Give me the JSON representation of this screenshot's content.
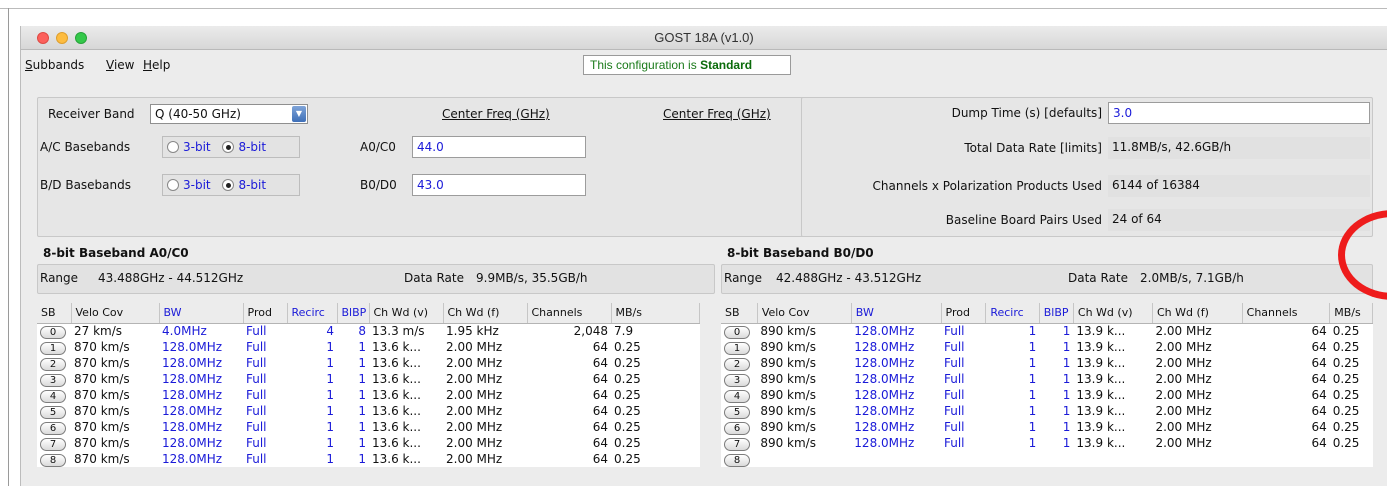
{
  "window": {
    "title": "GOST 18A (v1.0)"
  },
  "menu": {
    "items": [
      {
        "mnemonic": "S",
        "rest": "ubbands"
      },
      {
        "mnemonic": "V",
        "rest": "iew"
      },
      {
        "mnemonic": "H",
        "rest": "elp"
      }
    ]
  },
  "status": {
    "prefix": "This configuration is ",
    "value": "Standard"
  },
  "receiver": {
    "band_label": "Receiver Band",
    "band_value": "Q (40-50 GHz)",
    "ac_label": "A/C Basebands",
    "bd_label": "B/D Basebands",
    "opt3": "3-bit",
    "opt8": "8-bit",
    "ac_selected": "8-bit",
    "bd_selected": "8-bit",
    "center_freq_header_1": "Center Freq (GHz)",
    "center_freq_header_2": "Center Freq (GHz)",
    "a0_label": "A0/C0",
    "a0_value": "44.0",
    "b0_label": "B0/D0",
    "b0_value": "43.0"
  },
  "summary": {
    "dump_label": "Dump Time (s) [defaults]",
    "dump_value": "3.0",
    "rate_label": "Total Data Rate [limits]",
    "rate_value": "11.8MB/s, 42.6GB/h",
    "channels_label": "Channels x Polarization Products Used",
    "channels_value": "6144 of 16384",
    "boards_label": "Baseline Board Pairs Used",
    "boards_value": "24 of 64"
  },
  "columns": [
    "SB",
    "Velo Cov",
    "BW",
    "Prod",
    "Recirc",
    "BlBP",
    "Ch Wd (v)",
    "Ch Wd (f)",
    "Channels",
    "MB/s"
  ],
  "panel_a": {
    "title": "8-bit Baseband A0/C0",
    "range_label": "Range",
    "range_value": "43.488GHz - 44.512GHz",
    "rate_label": "Data Rate",
    "rate_value": "9.9MB/s, 35.5GB/h",
    "rows": [
      {
        "sb": "0",
        "velo": "27 km/s",
        "bw": "4.0MHz",
        "prod": "Full",
        "recirc": "4",
        "blbp": "8",
        "chv": "13.3 m/s",
        "chf": "1.95 kHz",
        "ch": "2,048",
        "mbs": "7.9"
      },
      {
        "sb": "1",
        "velo": "870 km/s",
        "bw": "128.0MHz",
        "prod": "Full",
        "recirc": "1",
        "blbp": "1",
        "chv": "13.6 k...",
        "chf": "2.00 MHz",
        "ch": "64",
        "mbs": "0.25"
      },
      {
        "sb": "2",
        "velo": "870 km/s",
        "bw": "128.0MHz",
        "prod": "Full",
        "recirc": "1",
        "blbp": "1",
        "chv": "13.6 k...",
        "chf": "2.00 MHz",
        "ch": "64",
        "mbs": "0.25"
      },
      {
        "sb": "3",
        "velo": "870 km/s",
        "bw": "128.0MHz",
        "prod": "Full",
        "recirc": "1",
        "blbp": "1",
        "chv": "13.6 k...",
        "chf": "2.00 MHz",
        "ch": "64",
        "mbs": "0.25"
      },
      {
        "sb": "4",
        "velo": "870 km/s",
        "bw": "128.0MHz",
        "prod": "Full",
        "recirc": "1",
        "blbp": "1",
        "chv": "13.6 k...",
        "chf": "2.00 MHz",
        "ch": "64",
        "mbs": "0.25"
      },
      {
        "sb": "5",
        "velo": "870 km/s",
        "bw": "128.0MHz",
        "prod": "Full",
        "recirc": "1",
        "blbp": "1",
        "chv": "13.6 k...",
        "chf": "2.00 MHz",
        "ch": "64",
        "mbs": "0.25"
      },
      {
        "sb": "6",
        "velo": "870 km/s",
        "bw": "128.0MHz",
        "prod": "Full",
        "recirc": "1",
        "blbp": "1",
        "chv": "13.6 k...",
        "chf": "2.00 MHz",
        "ch": "64",
        "mbs": "0.25"
      },
      {
        "sb": "7",
        "velo": "870 km/s",
        "bw": "128.0MHz",
        "prod": "Full",
        "recirc": "1",
        "blbp": "1",
        "chv": "13.6 k...",
        "chf": "2.00 MHz",
        "ch": "64",
        "mbs": "0.25"
      },
      {
        "sb": "8",
        "velo": "870 km/s",
        "bw": "128.0MHz",
        "prod": "Full",
        "recirc": "1",
        "blbp": "1",
        "chv": "13.6 k...",
        "chf": "2.00 MHz",
        "ch": "64",
        "mbs": "0.25"
      }
    ]
  },
  "panel_b": {
    "title": "8-bit Baseband B0/D0",
    "range_label": "Range",
    "range_value": "42.488GHz - 43.512GHz",
    "rate_label": "Data Rate",
    "rate_value": "2.0MB/s, 7.1GB/h",
    "rows": [
      {
        "sb": "0",
        "velo": "890 km/s",
        "bw": "128.0MHz",
        "prod": "Full",
        "recirc": "1",
        "blbp": "1",
        "chv": "13.9 k...",
        "chf": "2.00 MHz",
        "ch": "64",
        "mbs": "0.25"
      },
      {
        "sb": "1",
        "velo": "890 km/s",
        "bw": "128.0MHz",
        "prod": "Full",
        "recirc": "1",
        "blbp": "1",
        "chv": "13.9 k...",
        "chf": "2.00 MHz",
        "ch": "64",
        "mbs": "0.25"
      },
      {
        "sb": "2",
        "velo": "890 km/s",
        "bw": "128.0MHz",
        "prod": "Full",
        "recirc": "1",
        "blbp": "1",
        "chv": "13.9 k...",
        "chf": "2.00 MHz",
        "ch": "64",
        "mbs": "0.25"
      },
      {
        "sb": "3",
        "velo": "890 km/s",
        "bw": "128.0MHz",
        "prod": "Full",
        "recirc": "1",
        "blbp": "1",
        "chv": "13.9 k...",
        "chf": "2.00 MHz",
        "ch": "64",
        "mbs": "0.25"
      },
      {
        "sb": "4",
        "velo": "890 km/s",
        "bw": "128.0MHz",
        "prod": "Full",
        "recirc": "1",
        "blbp": "1",
        "chv": "13.9 k...",
        "chf": "2.00 MHz",
        "ch": "64",
        "mbs": "0.25"
      },
      {
        "sb": "5",
        "velo": "890 km/s",
        "bw": "128.0MHz",
        "prod": "Full",
        "recirc": "1",
        "blbp": "1",
        "chv": "13.9 k...",
        "chf": "2.00 MHz",
        "ch": "64",
        "mbs": "0.25"
      },
      {
        "sb": "6",
        "velo": "890 km/s",
        "bw": "128.0MHz",
        "prod": "Full",
        "recirc": "1",
        "blbp": "1",
        "chv": "13.9 k...",
        "chf": "2.00 MHz",
        "ch": "64",
        "mbs": "0.25"
      },
      {
        "sb": "7",
        "velo": "890 km/s",
        "bw": "128.0MHz",
        "prod": "Full",
        "recirc": "1",
        "blbp": "1",
        "chv": "13.9 k...",
        "chf": "2.00 MHz",
        "ch": "64",
        "mbs": "0.25"
      },
      {
        "sb": "8",
        "velo": "",
        "bw": "",
        "prod": "",
        "recirc": "",
        "blbp": "",
        "chv": "",
        "chf": "",
        "ch": "",
        "mbs": ""
      }
    ]
  },
  "colors": {
    "accent_blue": "#1a1ad8",
    "status_green": "#0a6b0a",
    "annotation_red": "#ee1c1c"
  },
  "icons": {
    "dropdown": "chevron-down-icon",
    "radio": "radio-icon"
  }
}
